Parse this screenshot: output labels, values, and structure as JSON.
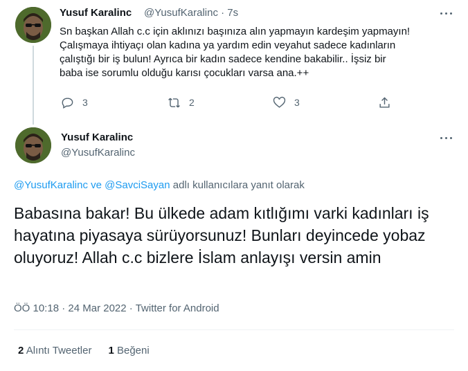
{
  "parent_tweet": {
    "author_name": "Yusuf Karalinc",
    "author_handle": "@YusufKaralinc",
    "separator": "·",
    "time": "7s",
    "text": "Sn başkan Allah c.c için aklınızı başınıza alın yapmayın kardeşim yapmayın!\nÇalışmaya ihtiyaçı olan kadına ya yardım edin veyahut sadece kadınların\nçalıştığı bir iş bulun! Ayrıca bir kadın sadece kendine bakabilir.. İşsiz bir\nbaba ise sorumlu olduğu karısı çocukları varsa ana.++",
    "reply_count": "3",
    "retweet_count": "2",
    "like_count": "3"
  },
  "main_tweet": {
    "author_name": "Yusuf Karalinc",
    "author_handle": "@YusufKaralinc",
    "reply_to_prefix_user": "@YusufKaralinc",
    "reply_to_and": "ve",
    "reply_to_user2": "@SavciSayan",
    "reply_to_suffix": "adlı kullanıcılara yanıt olarak",
    "text": "Babasına bakar! Bu ülkede adam kıtlığımı varki kadınları iş hayatına piyasaya sürüyorsunuz! Bunları deyincede yobaz oluyoruz! Allah c.c bizlere İslam anlayışı versin amin",
    "time": "ÖÖ 10:18",
    "date": "24 Mar 2022",
    "source": "Twitter for Android",
    "dot": "·",
    "quote_tweets_count": "2",
    "quote_tweets_label": "Alıntı Tweetler",
    "likes_count": "1",
    "likes_label": "Beğeni"
  },
  "icons": [
    "more-icon",
    "reply-icon",
    "retweet-icon",
    "like-icon",
    "share-icon",
    "avatar"
  ],
  "colors": {
    "link": "#1d9bf0",
    "muted": "#536471",
    "text": "#0f1419",
    "line": "#cfd9de"
  }
}
